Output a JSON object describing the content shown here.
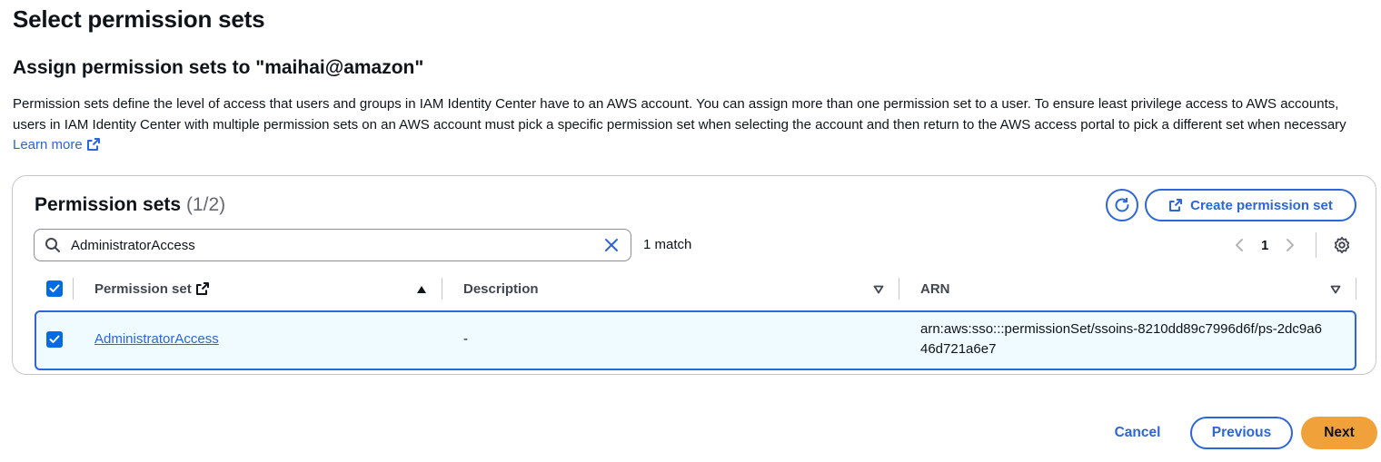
{
  "page": {
    "title": "Select permission sets",
    "section_title": "Assign permission sets to \"maihai@amazon\"",
    "description": "Permission sets define the level of access that users and groups in IAM Identity Center have to an AWS account. You can assign more than one permission set to a user. To ensure least privilege access to AWS accounts, users in IAM Identity Center with multiple permission sets on an AWS account must pick a specific permission set when selecting the account and then return to the AWS access portal to pick a different set when necessary",
    "learn_more": "Learn more"
  },
  "panel": {
    "title": "Permission sets",
    "count": "(1/2)",
    "create_button": "Create permission set",
    "search_value": "AdministratorAccess",
    "match_count": "1 match",
    "current_page": "1"
  },
  "table": {
    "columns": {
      "permission_set": "Permission set",
      "description": "Description",
      "arn": "ARN"
    },
    "rows": [
      {
        "selected": true,
        "permission_set": "AdministratorAccess",
        "description": "-",
        "arn": "arn:aws:sso:::permissionSet/ssoins-8210dd89c7996d6f/ps-2dc9a646d721a6e7"
      }
    ]
  },
  "footer": {
    "cancel": "Cancel",
    "previous": "Previous",
    "next": "Next"
  },
  "colors": {
    "link": "#2c66d8",
    "primary": "#f0a139",
    "checkbox": "#006ce0",
    "selected_row_bg": "#f0fbff"
  },
  "icons": [
    "external-link-icon",
    "refresh-icon",
    "search-icon",
    "clear-icon",
    "chevron-left-icon",
    "chevron-right-icon",
    "settings-icon",
    "sort-asc-icon",
    "sort-desc-icon",
    "checkbox-checked-icon"
  ]
}
